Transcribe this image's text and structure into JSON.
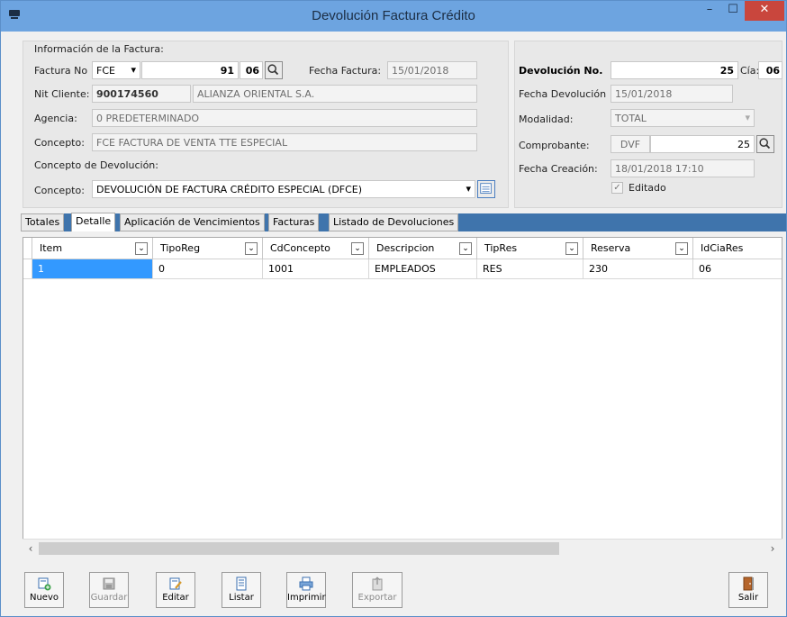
{
  "window": {
    "title": "Devolución Factura Crédito",
    "min_glyph": "–",
    "max_glyph": "☐",
    "close_glyph": "✕"
  },
  "factura": {
    "section_title": "Información de la Factura:",
    "factura_no_label": "Factura No",
    "factura_tipo": "FCE",
    "factura_tipo_arrow": "▾",
    "factura_numero": "91",
    "factura_cia": "06",
    "fecha_factura_label": "Fecha Factura:",
    "fecha_factura": "15/01/2018",
    "nit_label": "Nit Cliente:",
    "nit": "900174560",
    "cliente": "ALIANZA ORIENTAL S.A.",
    "agencia_label": "Agencia:",
    "agencia": "0 PREDETERMINADO",
    "concepto_label": "Concepto:",
    "concepto": "FCE FACTURA DE VENTA TTE ESPECIAL",
    "concepto_dev_title": "Concepto de Devolución:",
    "concepto_dev_label": "Concepto:",
    "concepto_dev": "DEVOLUCIÓN DE FACTURA CRÉDITO ESPECIAL (DFCE)",
    "concepto_dev_arrow": "▾"
  },
  "devolucion": {
    "numero_label": "Devolución No.",
    "numero": "25",
    "cia_label": "Cía:",
    "cia": "06",
    "fecha_label": "Fecha Devolución",
    "fecha": "15/01/2018",
    "modalidad_label": "Modalidad:",
    "modalidad": "TOTAL",
    "modalidad_arrow": "▾",
    "comprobante_label": "Comprobante:",
    "comprobante_tipo": "DVF",
    "comprobante_numero": "25",
    "creacion_label": "Fecha Creación:",
    "creacion": "18/01/2018 17:10",
    "editado_label": "Editado",
    "editado_check": "✓"
  },
  "tabs": [
    {
      "label": "Totales"
    },
    {
      "label": "Detalle"
    },
    {
      "label": "Aplicación de Vencimientos"
    },
    {
      "label": "Facturas"
    },
    {
      "label": "Listado de Devoluciones"
    }
  ],
  "grid": {
    "dropdown_glyph": "⌄",
    "columns": [
      "Item",
      "TipoReg",
      "CdConcepto",
      "Descripcion",
      "TipRes",
      "Reserva",
      "IdCiaRes"
    ],
    "rows": [
      [
        "1",
        "0",
        "1001",
        "EMPLEADOS",
        "RES",
        "230",
        "06"
      ]
    ],
    "scroll_left": "‹",
    "scroll_right": "›"
  },
  "toolbar": {
    "nuevo": "Nuevo",
    "guardar": "Guardar",
    "editar": "Editar",
    "listar": "Listar",
    "imprimir": "Imprimir",
    "exportar": "Exportar",
    "salir": "Salir"
  },
  "colors": {
    "titlebar": "#6da4e0",
    "close": "#c9463d",
    "tabstrip": "#3f74ac",
    "selection": "#3399ff"
  }
}
